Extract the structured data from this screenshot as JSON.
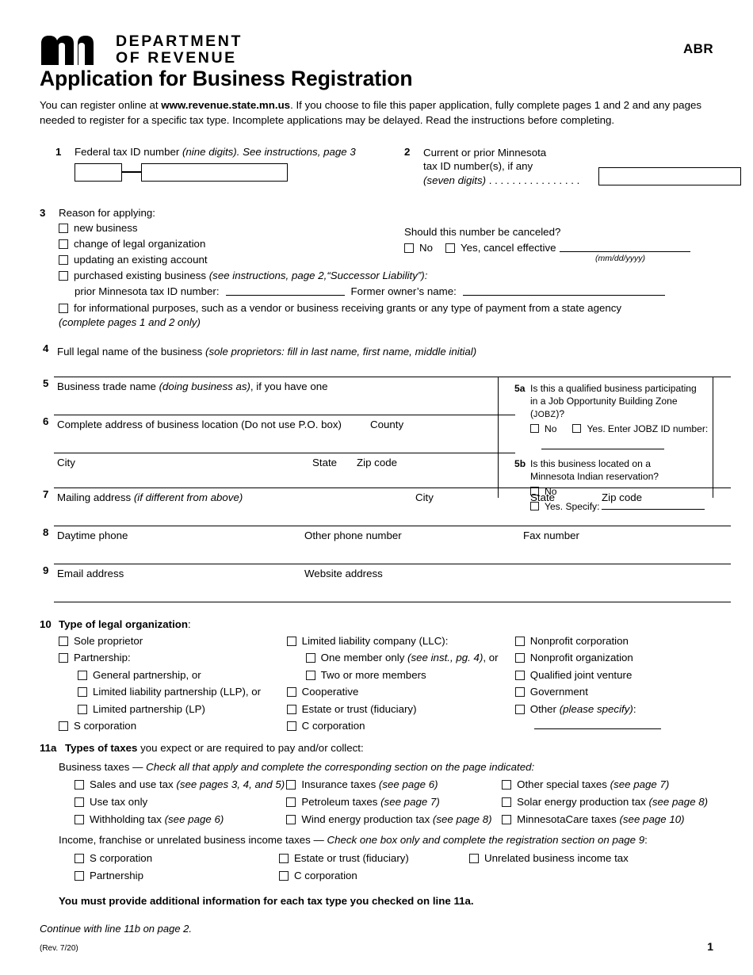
{
  "header": {
    "agency_line1": "DEPARTMENT",
    "agency_line2": "OF REVENUE",
    "form_code": "ABR",
    "title": "Application for Business Registration",
    "intro_a": "You can register online at ",
    "intro_url": "www.revenue.state.mn.us",
    "intro_b": ". If you choose to file this paper application, fully complete pages 1 and 2 and any pages needed to register for a specific tax type. Incomplete applications may be delayed. Read the instructions before completing.",
    "logo_name": "minnesota-department-of-revenue-logo"
  },
  "line1": {
    "num": "1",
    "label_plain": "Federal tax ID number ",
    "label_italic": "(nine digits). See instructions, page 3"
  },
  "line2": {
    "num": "2",
    "label_l1": "Current or prior Minnesota",
    "label_l2": "tax ID number(s), if any",
    "label_l3_italic": "(seven digits)",
    "dots": " . . . . . . . . . . . . . . . .",
    "cancel_question": "Should this number be canceled?",
    "cancel_no": "No",
    "cancel_yes": "Yes, cancel effective",
    "date_format": "(mm/dd/yyyy)"
  },
  "line3": {
    "num": "3",
    "label": "Reason for applying:",
    "options": [
      "new business",
      "change of legal organization",
      "updating an existing account"
    ],
    "purchased_plain": "purchased existing business ",
    "purchased_italic": "(see instructions, page 2,“Successor Liability”):",
    "prior_id_label": "prior Minnesota tax ID number:",
    "former_owner_label": "Former owner’s name:",
    "informational": "for informational purposes, such as a vendor or business receiving grants or any type of payment from a state agency",
    "informational_note": "(complete pages 1 and 2 only)"
  },
  "line4": {
    "num": "4",
    "label_plain": "Full legal name of the business ",
    "label_italic": "(sole proprietors: fill in last name, first name, middle initial)"
  },
  "line5": {
    "num": "5",
    "label_plain": "Business trade name ",
    "label_italic": "(doing business as)",
    "label_tail": ", if you have one"
  },
  "line6": {
    "num": "6",
    "label": "Complete address of business location (Do not use P.O. box)",
    "county": "County",
    "city": "City",
    "state": "State",
    "zip": "Zip code"
  },
  "line5a": {
    "num": "5a",
    "q_l1": "Is this a qualified business participating",
    "q_l2_a": "in a Job Opportunity Building Zone (",
    "q_l2_sc": "JOBZ",
    "q_l2_b": ")?",
    "no": "No",
    "yes": "Yes. Enter JOBZ ID number:"
  },
  "line5b": {
    "num": "5b",
    "q_l1": "Is this business located on a",
    "q_l2": "Minnesota Indian reservation?",
    "no": "No",
    "yes": "Yes. Specify:"
  },
  "line7": {
    "num": "7",
    "label_plain": "Mailing address ",
    "label_italic": "(if different from above)",
    "city": "City",
    "state": "State",
    "zip": "Zip code"
  },
  "line8": {
    "num": "8",
    "daytime": "Daytime phone",
    "other": "Other phone number",
    "fax": "Fax number"
  },
  "line9": {
    "num": "9",
    "email": "Email address",
    "website": "Website address"
  },
  "line10": {
    "num": "10",
    "head_bold": "Type of legal organization",
    "head_tail": ":",
    "col1": [
      {
        "label": "Sole proprietor",
        "sub": false
      },
      {
        "label": "Partnership:",
        "sub": false
      },
      {
        "label": "General partnership, or",
        "sub": true
      },
      {
        "label": "Limited liability partnership (LLP), or",
        "sub": true
      },
      {
        "label": "Limited partnership (LP)",
        "sub": true
      },
      {
        "label": "S corporation",
        "sub": false
      }
    ],
    "col2": [
      {
        "label": "Limited liability company (LLC):",
        "sub": false,
        "italic": ""
      },
      {
        "label": "One member only ",
        "sub": true,
        "italic": "(see inst., pg. 4)",
        "tail": ", or"
      },
      {
        "label": "Two or more members",
        "sub": true,
        "italic": ""
      },
      {
        "label": "Cooperative",
        "sub": false,
        "italic": ""
      },
      {
        "label": "Estate or trust (fiduciary)",
        "sub": false,
        "italic": ""
      },
      {
        "label": "C corporation",
        "sub": false,
        "italic": ""
      }
    ],
    "col3": [
      {
        "label": "Nonprofit corporation",
        "italic": ""
      },
      {
        "label": "Nonprofit organization",
        "italic": ""
      },
      {
        "label": "Qualified joint venture",
        "italic": ""
      },
      {
        "label": "Government",
        "italic": ""
      },
      {
        "label": "Other ",
        "italic": "(please specify)",
        "tail": ":"
      }
    ]
  },
  "line11a": {
    "num": "11a",
    "head_bold": "Types of taxes",
    "head_tail": " you expect or are required to pay and/or collect:",
    "business_plain": "Business taxes — ",
    "business_italic": "Check all that apply and complete the corresponding section on the page indicated:",
    "col1": [
      {
        "label": "Sales and use tax ",
        "italic": "(see pages 3, 4, and 5)"
      },
      {
        "label": "Use tax only",
        "italic": ""
      },
      {
        "label": "Withholding tax ",
        "italic": "(see page 6)"
      }
    ],
    "col2": [
      {
        "label": "Insurance taxes ",
        "italic": "(see page 6)"
      },
      {
        "label": "Petroleum taxes ",
        "italic": "(see page 7)"
      },
      {
        "label": "Wind energy production tax ",
        "italic": "(see page 8)"
      }
    ],
    "col3": [
      {
        "label": "Other special taxes ",
        "italic": "(see page 7)"
      },
      {
        "label": "Solar energy production tax ",
        "italic": "(see page 8)"
      },
      {
        "label": "MinnesotaCare taxes ",
        "italic": "(see page 10)"
      }
    ],
    "income_plain": "Income, franchise or unrelated business income taxes — ",
    "income_italic": "Check one box only and complete the registration section on page 9",
    "income_tail": ":",
    "income_col1": [
      "S corporation",
      "Partnership"
    ],
    "income_col2": [
      "Estate or trust (fiduciary)",
      "C corporation"
    ],
    "income_col3": [
      "Unrelated business income tax"
    ],
    "must_note": "You must provide additional information for each tax type you checked on line 11a.",
    "continue_note": "Continue with line 11b on page 2."
  },
  "footer": {
    "revision": "(Rev. 7/20)",
    "page_number": "1"
  }
}
